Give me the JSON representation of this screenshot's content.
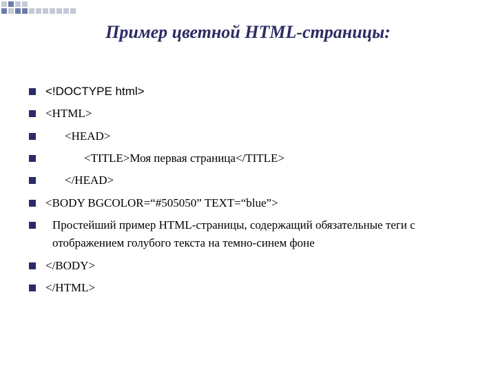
{
  "title": "Пример  цветной HTML-страницы:",
  "lines": {
    "l0": "<!DOCTYPE html>",
    "l1": "<HTML>",
    "l2": "<HEAD>",
    "l3": "<TITLE>Моя первая страница</TITLE>",
    "l4": "</HEAD>",
    "l5": "<BODY   BGCOLOR=“#505050” TEXT=“blue”>",
    "l6": "Простейший пример HTML-страницы, содержащий обязательные теги с отображением голубого текста   на темно-синем фоне",
    "l7": "</BODY>",
    "l8": "</HTML>"
  },
  "colors": {
    "accent": "#2b2b6a",
    "square_blue": "#6a7da8",
    "square_gray": "#c4c9d6"
  }
}
